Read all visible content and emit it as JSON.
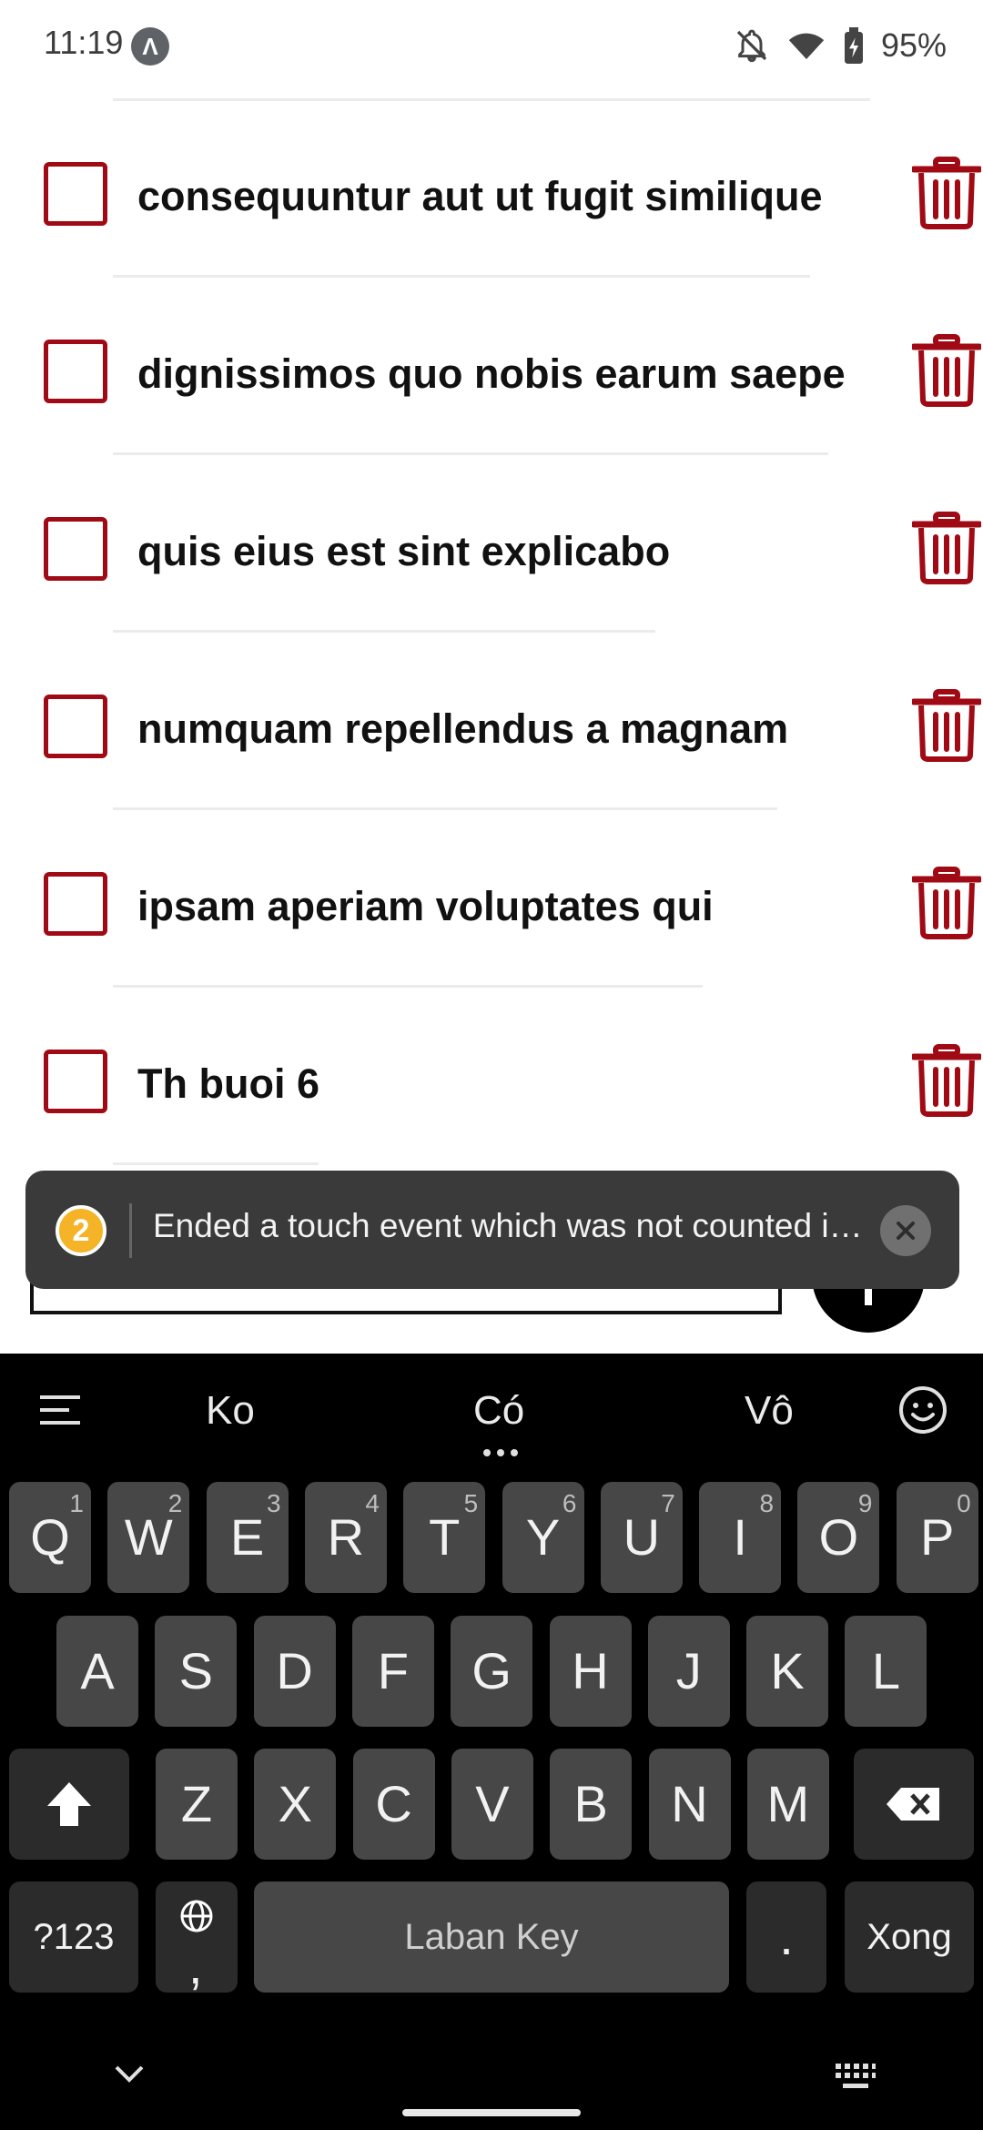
{
  "status_bar": {
    "time": "11:19",
    "app_icon_glyph": "Λ",
    "battery": "95%",
    "icons": [
      "notifications-off-icon",
      "wifi-icon",
      "battery-charging-icon"
    ]
  },
  "todos": [
    {
      "text": "consequuntur aut ut fugit similique",
      "checked": false
    },
    {
      "text": "dignissimos quo nobis earum saepe",
      "checked": false
    },
    {
      "text": "quis eius est sint explicabo",
      "checked": false
    },
    {
      "text": "numquam repellendus a magnam",
      "checked": false
    },
    {
      "text": "ipsam aperiam voluptates qui",
      "checked": false
    },
    {
      "text": "Th buoi 6",
      "checked": false
    }
  ],
  "toast": {
    "count": "2",
    "message": "Ended a touch event which was not counted in trackedTouchCount."
  },
  "keyboard": {
    "suggestions": [
      "Ko",
      "Có",
      "Vô"
    ],
    "row1": [
      {
        "label": "Q",
        "hint": "1"
      },
      {
        "label": "W",
        "hint": "2"
      },
      {
        "label": "E",
        "hint": "3"
      },
      {
        "label": "R",
        "hint": "4"
      },
      {
        "label": "T",
        "hint": "5"
      },
      {
        "label": "Y",
        "hint": "6"
      },
      {
        "label": "U",
        "hint": "7"
      },
      {
        "label": "I",
        "hint": "8"
      },
      {
        "label": "O",
        "hint": "9"
      },
      {
        "label": "P",
        "hint": "0"
      }
    ],
    "row2": [
      "A",
      "S",
      "D",
      "F",
      "G",
      "H",
      "J",
      "K",
      "L"
    ],
    "row3": [
      "Z",
      "X",
      "C",
      "V",
      "B",
      "N",
      "M"
    ],
    "symbols_label": "?123",
    "comma_label": ",",
    "space_label": "Laban Key",
    "period_label": ".",
    "enter_label": "Xong"
  },
  "colors": {
    "accent": "#a00a14",
    "keyboard_bg": "#000000",
    "key_bg": "#474747",
    "toast_bg": "#3a3a3a",
    "badge": "#f5b427"
  }
}
